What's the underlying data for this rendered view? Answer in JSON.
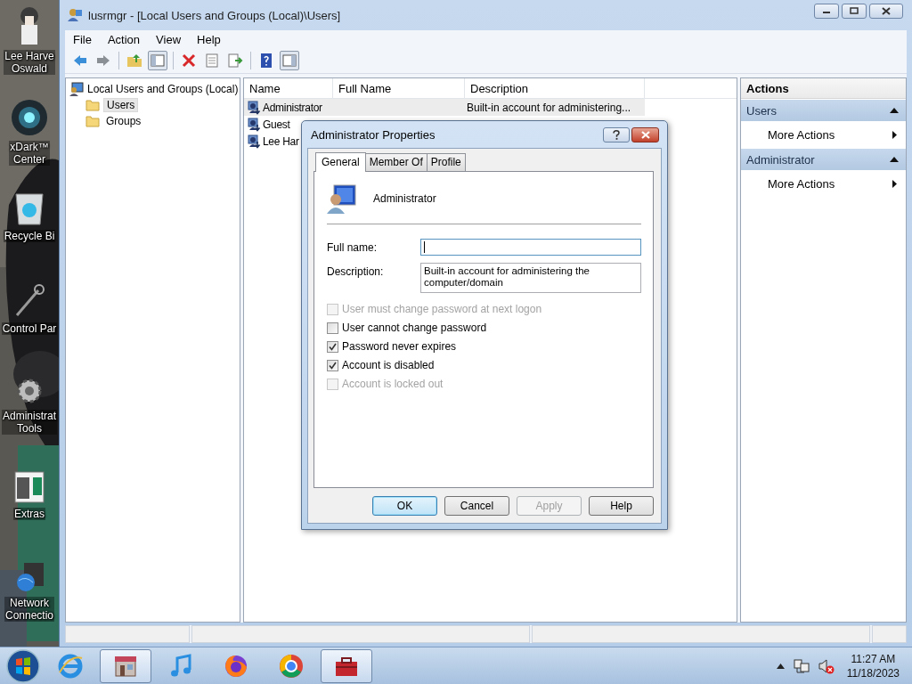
{
  "desktop": {
    "icons": [
      {
        "kind": "figure",
        "lines": [
          "Lee Harve",
          "Oswald"
        ]
      },
      {
        "kind": "orb",
        "lines": [
          "xDark™",
          "Center"
        ]
      },
      {
        "kind": "bin",
        "lines": [
          "Recycle Bi"
        ]
      },
      {
        "kind": "control",
        "lines": [
          "Control Par"
        ]
      },
      {
        "kind": "gear",
        "lines": [
          "Administrat",
          "Tools"
        ]
      },
      {
        "kind": "extras",
        "lines": [
          "Extras"
        ]
      },
      {
        "kind": "network",
        "lines": [
          "Network",
          "Connectio"
        ]
      }
    ]
  },
  "window": {
    "title": "lusrmgr - [Local Users and Groups (Local)\\Users]",
    "menu": [
      "File",
      "Action",
      "View",
      "Help"
    ],
    "tree": {
      "label": "Local Users and Groups (Local)",
      "children": [
        {
          "label": "Users",
          "selected": true
        },
        {
          "label": "Groups",
          "selected": false
        }
      ]
    },
    "list": {
      "columns": [
        "Name",
        "Full Name",
        "Description"
      ],
      "rows": [
        {
          "name": "Administrator",
          "description": "Built-in account for administering...",
          "selected": true
        },
        {
          "name": "Guest",
          "selected": false
        },
        {
          "name": "Lee Har",
          "selected": false
        }
      ]
    },
    "actions": {
      "title": "Actions",
      "sections": [
        {
          "title": "Users",
          "expanded": true,
          "items": [
            "More Actions"
          ]
        },
        {
          "title": "Administrator",
          "expanded": true,
          "items": [
            "More Actions"
          ]
        }
      ]
    }
  },
  "dialog": {
    "title": "Administrator Properties",
    "tabs": [
      {
        "label": "General",
        "selected": true
      },
      {
        "label": "Member Of",
        "selected": false
      },
      {
        "label": "Profile",
        "selected": false
      }
    ],
    "user": "Administrator",
    "fields": [
      {
        "label": "Full name:",
        "focused": true
      },
      {
        "label": "Description:",
        "value": "Built-in account for administering the computer/domain",
        "focused": false
      }
    ],
    "checkboxes": [
      {
        "label": "User must change password at next logon",
        "checked": false,
        "disabled": true
      },
      {
        "label": "User cannot change password",
        "checked": false,
        "disabled": false
      },
      {
        "label": "Password never expires",
        "checked": true,
        "disabled": false
      },
      {
        "label": "Account is disabled",
        "checked": true,
        "disabled": false
      },
      {
        "label": "Account is locked out",
        "checked": false,
        "disabled": true
      }
    ],
    "buttons": [
      {
        "label": "OK",
        "default": true,
        "disabled": false
      },
      {
        "label": "Cancel",
        "default": false,
        "disabled": false
      },
      {
        "label": "Apply",
        "default": false,
        "disabled": true
      },
      {
        "label": "Help",
        "default": false,
        "disabled": false
      }
    ]
  },
  "taskbar": {
    "apps": [
      {
        "kind": "browser-e",
        "active": false
      },
      {
        "kind": "store",
        "active": true
      },
      {
        "kind": "music",
        "active": false
      },
      {
        "kind": "fox",
        "active": false
      },
      {
        "kind": "wheel",
        "active": false
      },
      {
        "kind": "toolbox",
        "active": true
      }
    ],
    "clock": {
      "time": "11:27 AM",
      "date": "11/18/2023"
    }
  }
}
